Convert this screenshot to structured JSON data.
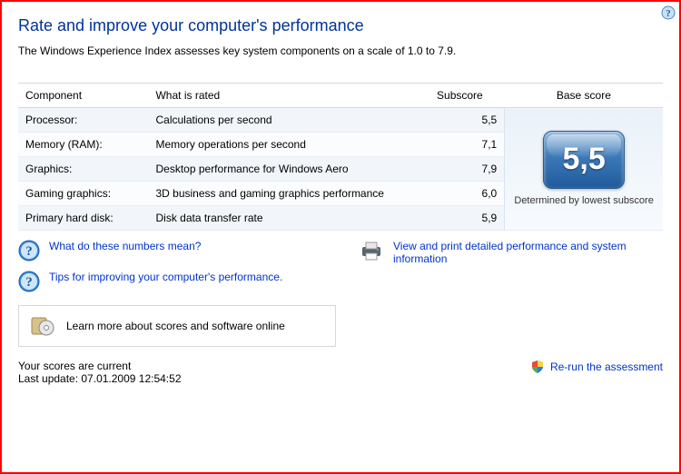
{
  "title": "Rate and improve your computer's performance",
  "intro": "The Windows Experience Index assesses key system components on a scale of 1.0 to 7.9.",
  "headers": {
    "component": "Component",
    "rated": "What is rated",
    "subscore": "Subscore",
    "basescore": "Base score"
  },
  "rows": [
    {
      "component": "Processor:",
      "rated": "Calculations per second",
      "sub": "5,5"
    },
    {
      "component": "Memory (RAM):",
      "rated": "Memory operations per second",
      "sub": "7,1"
    },
    {
      "component": "Graphics:",
      "rated": "Desktop performance for Windows Aero",
      "sub": "7,9"
    },
    {
      "component": "Gaming graphics:",
      "rated": "3D business and gaming graphics performance",
      "sub": "6,0"
    },
    {
      "component": "Primary hard disk:",
      "rated": "Disk data transfer rate",
      "sub": "5,9"
    }
  ],
  "base": {
    "score": "5,5",
    "caption": "Determined by lowest subscore"
  },
  "links": {
    "numbers": "What do these numbers mean?",
    "tips": "Tips for improving your computer's performance.",
    "print": "View and print detailed performance and system information",
    "learn": "Learn more about scores and software online"
  },
  "footer": {
    "current": "Your scores are current",
    "update": "Last update: 07.01.2009 12:54:52",
    "rerun": "Re-run the assessment"
  }
}
